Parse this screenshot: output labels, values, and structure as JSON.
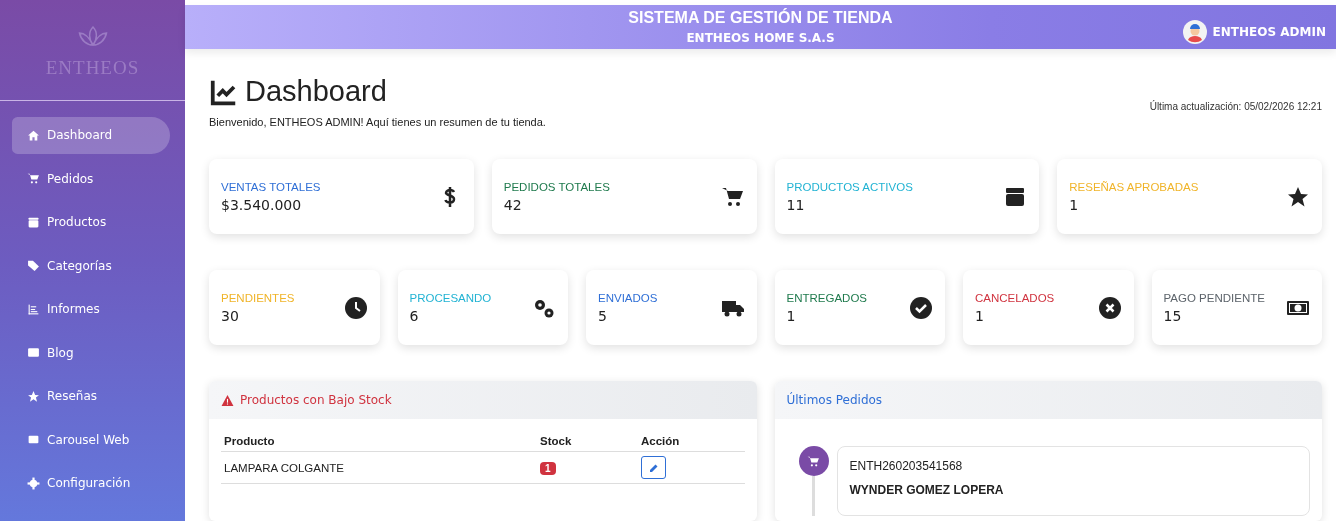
{
  "sidebar": {
    "logo": "ENTHEOS",
    "items": [
      {
        "label": "Dashboard",
        "selected": true
      },
      {
        "label": "Pedidos",
        "selected": false
      },
      {
        "label": "Productos",
        "selected": false
      },
      {
        "label": "Categorías",
        "selected": false
      },
      {
        "label": "Informes",
        "selected": false
      },
      {
        "label": "Blog",
        "selected": false
      },
      {
        "label": "Reseñas",
        "selected": false
      },
      {
        "label": "Carousel Web",
        "selected": false
      },
      {
        "label": "Configuración",
        "selected": false
      }
    ]
  },
  "header": {
    "title": "SISTEMA DE GESTIÓN DE TIENDA",
    "subtitle": "ENTHEOS HOME S.A.S",
    "user": "ENTHEOS ADMIN"
  },
  "page": {
    "title": "Dashboard",
    "welcome": "Bienvenido, ENTHEOS ADMIN! Aquí tienes un resumen de tu tienda.",
    "updated": "Última actualización: 05/02/2026 12:21"
  },
  "summary_cards": [
    {
      "label": "VENTAS TOTALES",
      "value": "$3.540.000",
      "color": "#2f6fd6"
    },
    {
      "label": "PEDIDOS TOTALES",
      "value": "42",
      "color": "#1f7a4d"
    },
    {
      "label": "PRODUCTOS ACTIVOS",
      "value": "11",
      "color": "#22b3d3"
    },
    {
      "label": "RESEÑAS APROBADAS",
      "value": "1",
      "color": "#f0b429"
    }
  ],
  "status_cards": [
    {
      "label": "PENDIENTES",
      "value": "30",
      "color": "#f0b429"
    },
    {
      "label": "PROCESANDO",
      "value": "6",
      "color": "#22b3d3"
    },
    {
      "label": "ENVIADOS",
      "value": "5",
      "color": "#2f6fd6"
    },
    {
      "label": "ENTREGADOS",
      "value": "1",
      "color": "#1f7a4d"
    },
    {
      "label": "CANCELADOS",
      "value": "1",
      "color": "#d0333f"
    },
    {
      "label": "PAGO PENDIENTE",
      "value": "15",
      "color": "#5c636a"
    }
  ],
  "low_stock": {
    "title": "Productos con Bajo Stock",
    "columns": [
      "Producto",
      "Stock",
      "Acción"
    ],
    "rows": [
      {
        "product": "LAMPARA COLGANTE",
        "stock": "1"
      }
    ]
  },
  "recent_orders": {
    "title": "Últimos Pedidos",
    "orders": [
      {
        "code": "ENTH260203541568",
        "customer": "WYNDER GOMEZ LOPERA"
      }
    ]
  }
}
